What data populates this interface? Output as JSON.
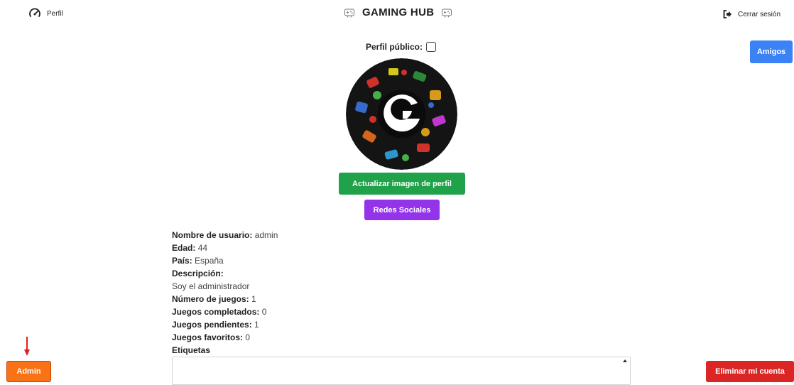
{
  "nav": {
    "profile_label": "Perfil",
    "brand_title": "GAMING HUB",
    "logout_label": "Cerrar sesión"
  },
  "profile": {
    "public_label": "Perfil público:",
    "public_checked": false,
    "friends_button": "Amigos",
    "update_image_button": "Actualizar imagen de perfil",
    "social_button": "Redes Sociales"
  },
  "details": {
    "username_label": "Nombre de usuario:",
    "username": "admin",
    "age_label": "Edad:",
    "age": "44",
    "country_label": "País:",
    "country": "España",
    "description_label": "Descripción:",
    "description": "Soy el administrador",
    "games_count_label": "Número de juegos:",
    "games_count": "1",
    "completed_label": "Juegos completados:",
    "completed": "0",
    "pending_label": "Juegos pendientes:",
    "pending": "1",
    "favorites_label": "Juegos favoritos:",
    "favorites": "0",
    "tags_label": "Etiquetas"
  },
  "footer": {
    "admin_button": "Admin",
    "delete_button": "Eliminar mi cuenta"
  },
  "colors": {
    "friends": "#3b82f6",
    "update": "#1fa24a",
    "social": "#9333ea",
    "admin": "#f97316",
    "delete": "#dc2626",
    "annotation_arrow": "#e11d1d"
  },
  "icons": {
    "profile": "speedometer-icon",
    "brand": "gamepad-icon",
    "logout": "sign-out-icon",
    "annotation": "red-down-arrow"
  }
}
